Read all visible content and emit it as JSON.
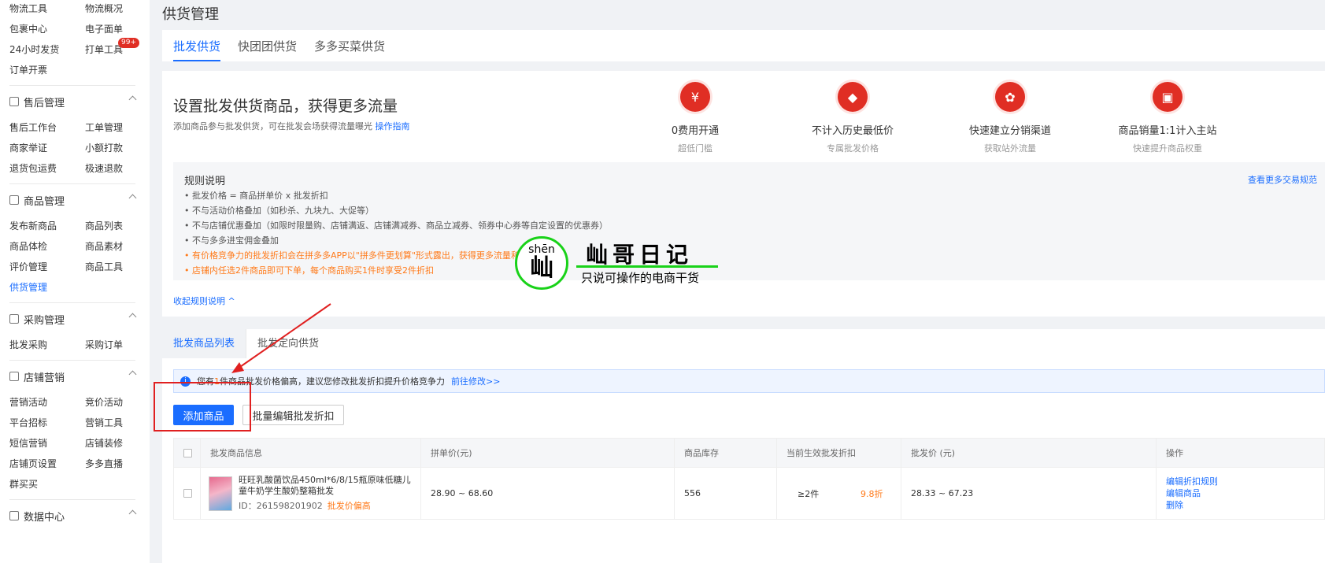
{
  "sidebar": {
    "top_items": [
      "物流工具",
      "物流概况",
      "包裹中心",
      "电子面单",
      "24小时发货",
      "打单工具",
      "订单开票"
    ],
    "top_badge": "99+",
    "groups": [
      {
        "title": "售后管理",
        "items": [
          "售后工作台",
          "工单管理",
          "商家举证",
          "小额打款",
          "退货包运费",
          "极速退款"
        ]
      },
      {
        "title": "商品管理",
        "items": [
          "发布新商品",
          "商品列表",
          "商品体检",
          "商品素材",
          "评价管理",
          "商品工具",
          "供货管理"
        ]
      },
      {
        "title": "采购管理",
        "items": [
          "批发采购",
          "采购订单"
        ]
      },
      {
        "title": "店铺营销",
        "items": [
          "营销活动",
          "竞价活动",
          "平台招标",
          "营销工具",
          "短信营销",
          "店铺装修",
          "店铺页设置",
          "多多直播",
          "群买买"
        ]
      },
      {
        "title": "数据中心",
        "items": []
      }
    ]
  },
  "page": {
    "title": "供货管理",
    "tabs": [
      "批发供货",
      "快团团供货",
      "多多买菜供货"
    ]
  },
  "banner": {
    "title": "设置批发供货商品，获得更多流量",
    "subtitle": "添加商品参与批发供货，可在批发会场获得流量曝光",
    "guide_link": "操作指南",
    "features": [
      {
        "icon": "yen-icon",
        "glyph": "¥",
        "title": "0费用开通",
        "sub": "超低门槛"
      },
      {
        "icon": "diamond-icon",
        "glyph": "◆",
        "title": "不计入历史最低价",
        "sub": "专属批发价格"
      },
      {
        "icon": "network-icon",
        "glyph": "✿",
        "title": "快速建立分销渠道",
        "sub": "获取站外流量"
      },
      {
        "icon": "chart-icon",
        "glyph": "▣",
        "title": "商品销量1:1计入主站",
        "sub": "快速提升商品权重"
      }
    ]
  },
  "rules": {
    "title": "规则说明",
    "more_link": "查看更多交易规范",
    "items": [
      "• 批发价格 = 商品拼单价 x 批发折扣",
      "• 不与活动价格叠加（如秒杀、九块九、大促等）",
      "• 不与店铺优惠叠加（如限时限量购、店铺满返、店铺满减券、商品立减券、领券中心券等自定设置的优惠券）",
      "• 不与多多进宝佣金叠加",
      "• 有价格竞争力的批发折扣会在拼多多APP以\"拼多件更划算\"形式露出，获得更多流量和曝光",
      "• 店铺内任选2件商品即可下单，每个商品购买1件时享受2件折扣"
    ],
    "collapse_label": "收起规则说明 ^"
  },
  "list": {
    "subtabs": [
      "批发商品列表",
      "批发定向供货"
    ],
    "notice_prefix": "您有",
    "notice_count": "1",
    "notice_suffix": "件商品批发价格偏高，建议您修改批发折扣提升价格竞争力",
    "notice_link": "前往修改>>",
    "add_button": "添加商品",
    "batch_button": "批量编辑批发折扣",
    "columns": [
      "批发商品信息",
      "拼单价(元)",
      "商品库存",
      "当前生效批发折扣",
      "批发价 (元)",
      "操作"
    ],
    "rows": [
      {
        "title": "旺旺乳酸菌饮品450ml*6/8/15瓶原味低糖儿童牛奶学生酸奶整箱批发",
        "id_text": "ID：261598201902",
        "warn": "批发价偏高",
        "price": "28.90 ~ 68.60",
        "stock": "556",
        "min_qty": "≥2件",
        "discount": "9.8折",
        "wholesale": "28.33 ~ 67.23",
        "ops": [
          "编辑折扣规则",
          "编辑商品",
          "删除"
        ]
      }
    ]
  },
  "watermark": {
    "pinyin": "shēn",
    "char": "屾",
    "name": "屾哥日记",
    "tagline": "只说可操作的电商干货"
  },
  "colors": {
    "accent": "#1a6dff",
    "brand_red": "#e02e24",
    "warning": "#ff7a1a",
    "watermark_green": "#19d219"
  }
}
